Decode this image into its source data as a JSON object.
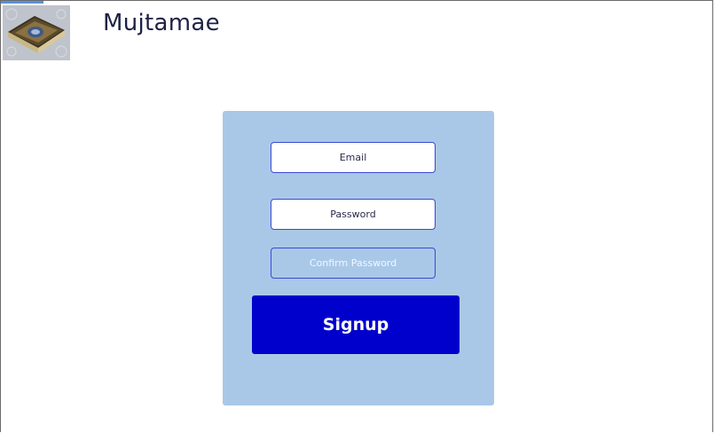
{
  "app": {
    "title": "Mujtamae",
    "logo_icon": "book-icon"
  },
  "form": {
    "email_placeholder": "Email",
    "password_placeholder": "Password",
    "confirm_password_placeholder": "Confirm Password",
    "signup_label": "Signup"
  },
  "colors": {
    "card_background": "#a9c8e8",
    "button_background": "#0000cc",
    "field_border": "#3b49d6",
    "title_color": "#1c2244"
  }
}
